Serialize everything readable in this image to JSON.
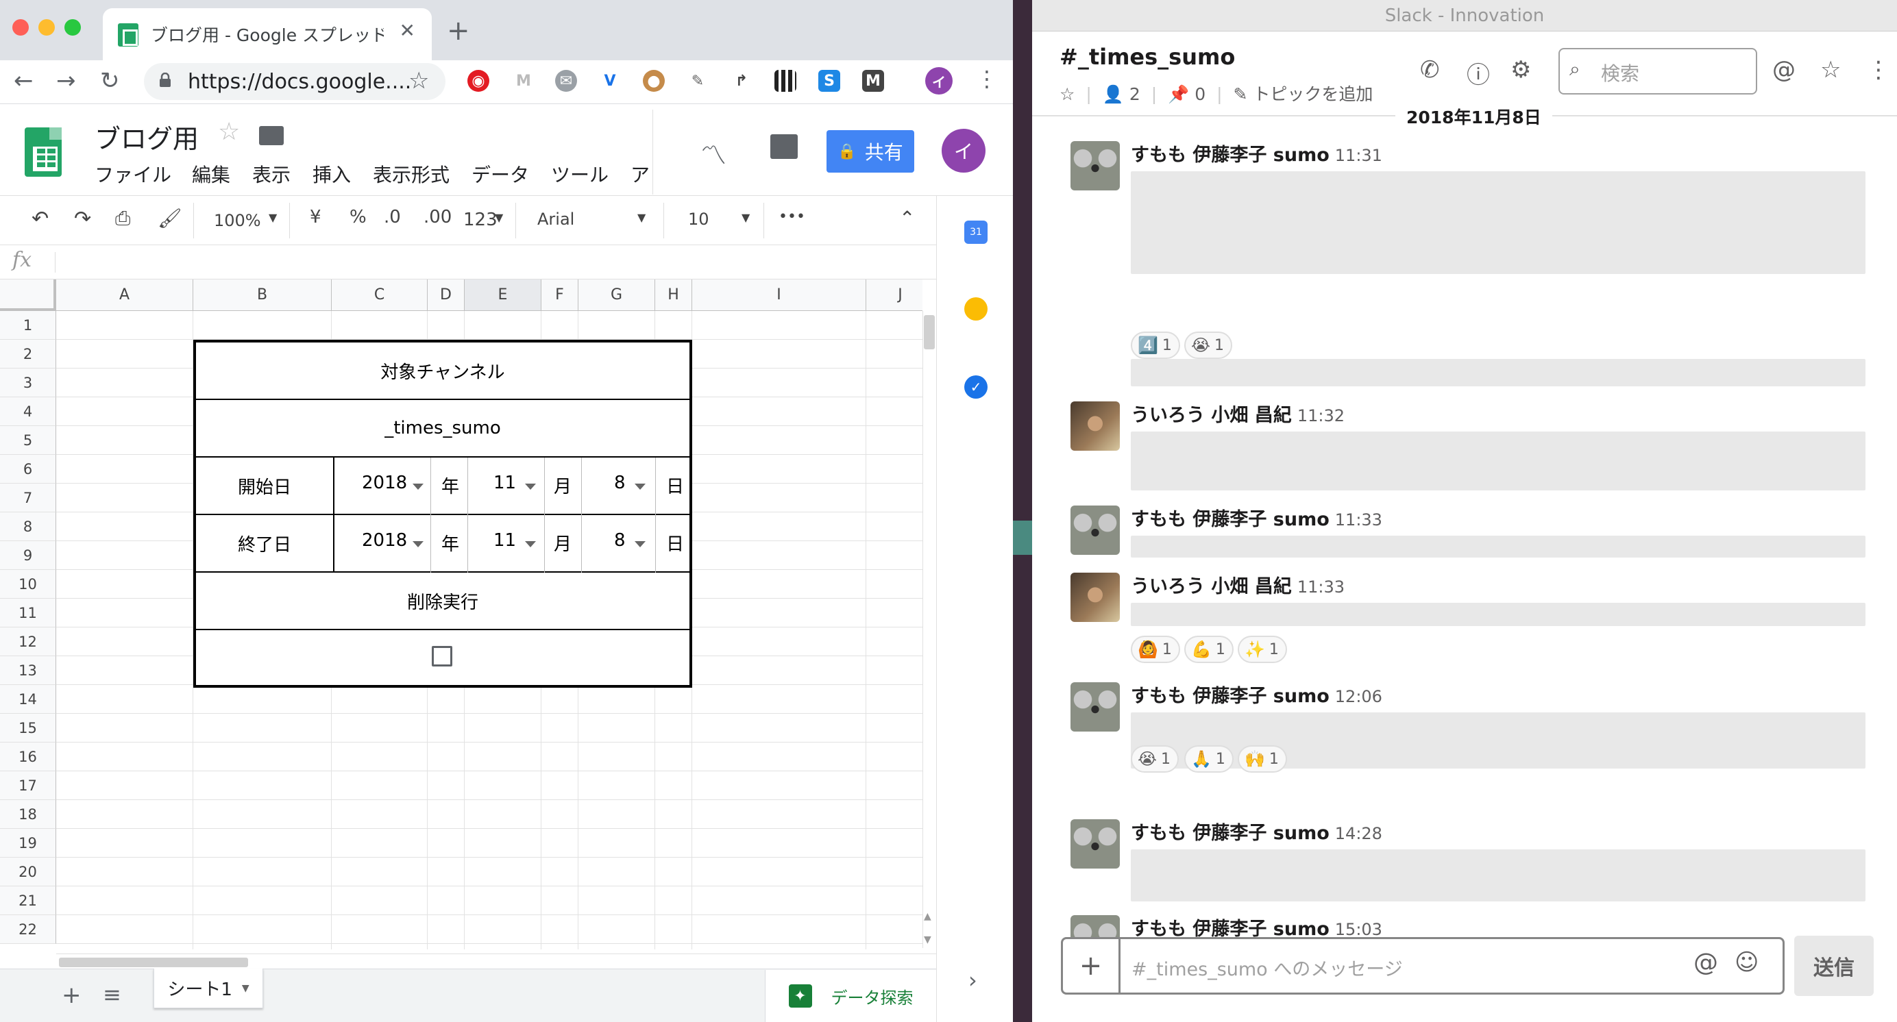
{
  "chrome": {
    "tab_title": "ブログ用 - Google スプレッドシー",
    "url": "https://docs.google....",
    "new_tab": "+",
    "close": "✕"
  },
  "sheets": {
    "doc_title": "ブログ用",
    "menus": [
      "ファイル",
      "編集",
      "表示",
      "挿入",
      "表示形式",
      "データ",
      "ツール",
      "ア"
    ],
    "share_label": "共有",
    "avatar_letter": "イ",
    "toolbar": {
      "zoom": "100%",
      "currency": "¥",
      "percent": "%",
      "dec_less": ".0",
      "dec_more": ".00",
      "format": "123",
      "font": "Arial",
      "font_size": "10",
      "more": "•••"
    },
    "fx": "fx",
    "columns": [
      "A",
      "B",
      "C",
      "D",
      "E",
      "F",
      "G",
      "H",
      "I",
      "J"
    ],
    "rows": [
      "1",
      "2",
      "3",
      "4",
      "5",
      "6",
      "7",
      "8",
      "9",
      "10",
      "11",
      "12",
      "13",
      "14",
      "15",
      "16",
      "17",
      "18",
      "19",
      "20",
      "21",
      "22"
    ],
    "table": {
      "target_label": "対象チャンネル",
      "channel": "_times_sumo",
      "start_label": "開始日",
      "end_label": "終了日",
      "start": {
        "year": "2018",
        "month": "11",
        "day": "8"
      },
      "end": {
        "year": "2018",
        "month": "11",
        "day": "8"
      },
      "year_unit": "年",
      "month_unit": "月",
      "day_unit": "日",
      "delete_label": "削除実行",
      "checkbox_checked": false
    },
    "sheet_tab": "シート1",
    "explore_label": "データ探索"
  },
  "slack": {
    "window_title": "Slack - Innovation",
    "channel": "#_times_sumo",
    "members": "2",
    "pins": "0",
    "topic": "トピックを追加",
    "search_placeholder": "検索",
    "date": "2018年11月8日",
    "messages": [
      {
        "name": "すもも 伊藤李子 sumo",
        "time": "11:31",
        "reactions": [
          {
            "emoji": "4️⃣",
            "count": "1"
          },
          {
            "emoji": "😭",
            "count": "1"
          }
        ]
      },
      {
        "name": "ういろう 小畑 昌紀",
        "time": "11:32",
        "reactions": []
      },
      {
        "name": "すもも 伊藤李子 sumo",
        "time": "11:33",
        "reactions": []
      },
      {
        "name": "ういろう 小畑 昌紀",
        "time": "11:33",
        "reactions": [
          {
            "emoji": "🙆",
            "count": "1"
          },
          {
            "emoji": "💪",
            "count": "1"
          },
          {
            "emoji": "✨",
            "count": "1"
          }
        ]
      },
      {
        "name": "すもも 伊藤李子 sumo",
        "time": "12:06",
        "reactions": [
          {
            "emoji": "😭",
            "count": "1"
          },
          {
            "emoji": "🙏",
            "count": "1"
          },
          {
            "emoji": "🙌",
            "count": "1"
          }
        ]
      },
      {
        "name": "すもも 伊藤李子 sumo",
        "time": "14:28",
        "reactions": []
      },
      {
        "name": "すもも 伊藤李子 sumo",
        "time": "15:03",
        "reactions": []
      }
    ],
    "composer_placeholder": "#_times_sumo へのメッセージ",
    "send_label": "送信"
  }
}
